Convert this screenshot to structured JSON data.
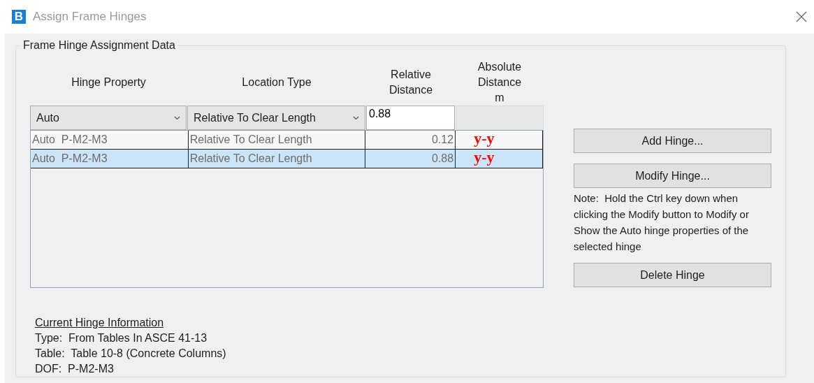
{
  "window": {
    "icon_letter": "B",
    "title": "Assign Frame Hinges"
  },
  "group": {
    "title": "Frame Hinge Assignment Data"
  },
  "table": {
    "columns": [
      {
        "label": "Hinge Property"
      },
      {
        "label": "Location Type"
      },
      {
        "label": "Relative Distance"
      },
      {
        "label": "Absolute Distance",
        "unit": "m"
      }
    ],
    "edit_row": {
      "hinge_property": "Auto",
      "location_type": "Relative To Clear Length",
      "relative_distance": "0.88"
    },
    "rows": [
      {
        "hinge_property": "Auto  P-M2-M3",
        "location_type": "Relative To Clear Length",
        "relative_distance": "0.12",
        "absolute_distance": "y-y",
        "selected": false
      },
      {
        "hinge_property": "Auto  P-M2-M3",
        "location_type": "Relative To Clear Length",
        "relative_distance": "0.88",
        "absolute_distance": "y-y",
        "selected": true
      }
    ]
  },
  "side": [
    {
      "kind": "button",
      "label": "Add Hinge..."
    },
    {
      "kind": "button",
      "label": "Modify Hinge..."
    },
    {
      "kind": "note",
      "text": "Note:  Hold the Ctrl key down when clicking the Modify button to Modify or Show the Auto hinge properties of the selected hinge"
    },
    {
      "kind": "button",
      "label": "Delete Hinge"
    }
  ],
  "info": {
    "heading": "Current Hinge Information",
    "lines": [
      "Type:  From Tables In ASCE 41-13",
      "Table:  Table 10-8 (Concrete Columns)",
      "DOF:  P-M2-M3"
    ]
  }
}
